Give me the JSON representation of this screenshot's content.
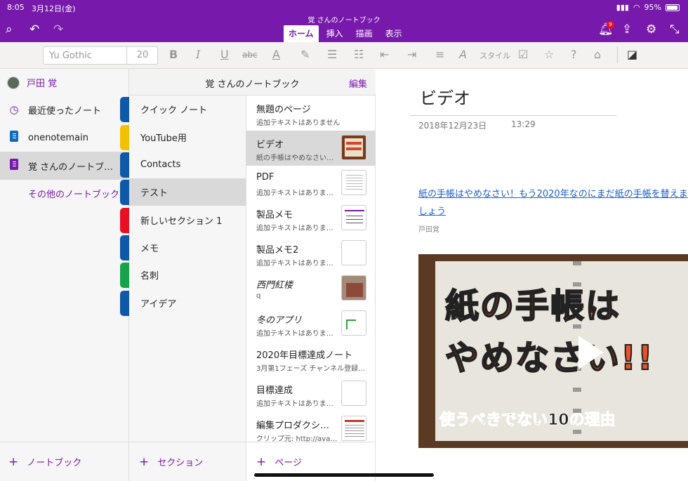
{
  "status": {
    "time": "8:05",
    "date": "3月12日(金)",
    "battery": "95%"
  },
  "titlebar": {
    "notebook_title": "覚 さんのノートブック",
    "tabs": [
      {
        "label": "ホーム",
        "active": true
      },
      {
        "label": "挿入",
        "active": false
      },
      {
        "label": "描画",
        "active": false
      },
      {
        "label": "表示",
        "active": false
      }
    ],
    "notification_count": "9",
    "accent": "#7719aa"
  },
  "ribbon": {
    "font_name": "Yu Gothic",
    "font_size": "20",
    "style_label": "スタイル"
  },
  "sidebar": {
    "user": "戸田 覚",
    "items": [
      {
        "label": "最近使ったノート",
        "icon": "clock-icon"
      },
      {
        "label": "onenotemain",
        "icon": "notebook-icon",
        "color": "#0f6cbd"
      },
      {
        "label": "覚 さんのノートブ…",
        "icon": "notebook-icon",
        "color": "#7719aa"
      }
    ],
    "more_notebooks": "その他のノートブック",
    "add_notebook": "ノートブック"
  },
  "sections_header": {
    "title": "覚 さんのノートブック",
    "edit": "編集"
  },
  "sections": [
    {
      "label": "クイック ノート",
      "color": "#0f5aa8"
    },
    {
      "label": "YouTube用",
      "color": "#f2c200"
    },
    {
      "label": "Contacts",
      "color": "#0f5aa8"
    },
    {
      "label": "テスト",
      "color": "#0f5aa8"
    },
    {
      "label": "新しいセクション 1",
      "color": "#e81123"
    },
    {
      "label": "メモ",
      "color": "#0f5aa8"
    },
    {
      "label": "名刺",
      "color": "#16a34a"
    },
    {
      "label": "アイデア",
      "color": "#0f5aa8"
    }
  ],
  "add_section": "セクション",
  "pages": [
    {
      "title": "無題のページ",
      "snippet": "追加テキストはありません"
    },
    {
      "title": "ビデオ",
      "snippet": "紙の手帳はやめなさい…"
    },
    {
      "title": "PDF",
      "snippet": "追加テキストはありま…"
    },
    {
      "title": "製品メモ",
      "snippet": "追加テキストはありま…"
    },
    {
      "title": "製品メモ2",
      "snippet": "追加テキストはありま…"
    },
    {
      "title": "西門紅楼",
      "snippet": "q"
    },
    {
      "title": "冬のアプリ",
      "snippet": "追加テキストはありま…"
    },
    {
      "title": "2020年目標達成ノート",
      "snippet": "3月第1フェーズ チャンネル登録…"
    },
    {
      "title": "目標達成",
      "snippet": "追加テキストはありま…"
    },
    {
      "title": "編集プロダクシ…",
      "snippet": "クリップ元: http://ava…"
    }
  ],
  "add_page": "ページ",
  "page": {
    "title": "ビデオ",
    "date": "2018年12月23日",
    "time": "13:29",
    "link": "紙の手帳はやめなさい！もう2020年なのにまだ紙の手帳を替えましょう",
    "author": "戸田覚",
    "video_line1": "紙の手帳は",
    "video_line2": "やめなさい!!",
    "video_line3": "使うべきでない10の理由"
  }
}
